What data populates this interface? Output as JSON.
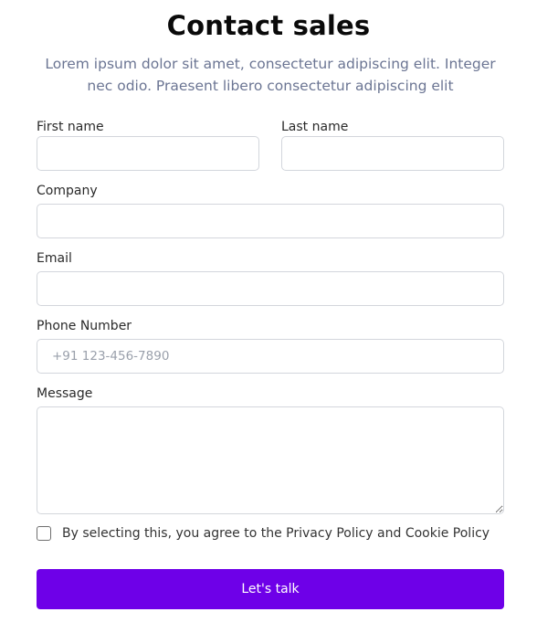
{
  "header": {
    "title": "Contact sales",
    "subtitle": "Lorem ipsum dolor sit amet, consectetur adipiscing elit. Integer nec odio. Praesent libero consectetur adipiscing elit"
  },
  "form": {
    "first_name": {
      "label": "First name",
      "value": "",
      "placeholder": ""
    },
    "last_name": {
      "label": "Last name",
      "value": "",
      "placeholder": ""
    },
    "company": {
      "label": "Company",
      "value": "",
      "placeholder": ""
    },
    "email": {
      "label": "Email",
      "value": "",
      "placeholder": ""
    },
    "phone": {
      "label": "Phone Number",
      "value": "",
      "placeholder": "+91 123-456-7890"
    },
    "message": {
      "label": "Message",
      "value": "",
      "placeholder": ""
    },
    "consent": {
      "text": "By selecting this, you agree to the Privacy Policy and Cookie Policy",
      "checked": false
    },
    "submit_label": "Let's talk"
  },
  "colors": {
    "accent": "#6e00e8",
    "subtitle": "#6b7593",
    "border": "#d3d6dc"
  }
}
